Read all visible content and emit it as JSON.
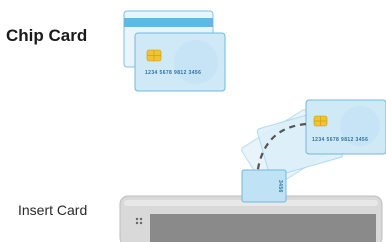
{
  "labels": {
    "title": "Chip Card",
    "insert": "Insert Card"
  },
  "card": {
    "number": "1234 5678 9812 3456",
    "edge_number": "3456"
  },
  "colors": {
    "card_fill": "#cfe9f7",
    "card_stroke": "#6fb9e0",
    "chip": "#f2c230",
    "terminal_body": "#d9d9d9"
  }
}
